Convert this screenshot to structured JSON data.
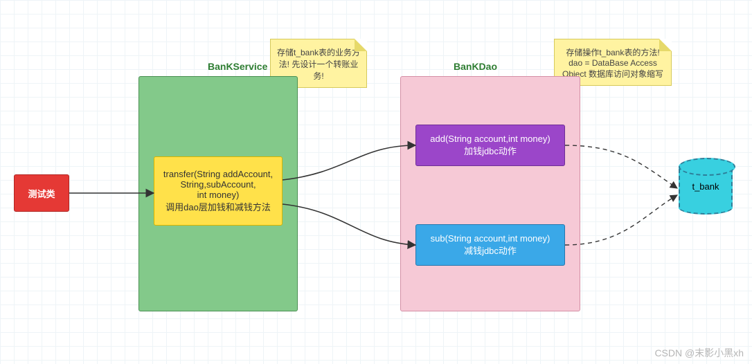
{
  "titles": {
    "service": "BanKService",
    "dao": "BanKDao"
  },
  "notes": {
    "service": "存储t_bank表的业务方法!\n先设计一个转账业务!",
    "dao": "存储操作t_bank表的方法!\ndao = DataBase Access Object\n数据库访问对象缩写"
  },
  "boxes": {
    "test": "测试类",
    "transfer": "transfer(String addAccount,\nString,subAccount,\nint money)\n调用dao层加钱和减钱方法",
    "add": "add(String account,int money)\n加钱jdbc动作",
    "sub": "sub(String account,int money)\n减钱jdbc动作",
    "db": "t_bank"
  },
  "watermark": "CSDN @末影小黑xh"
}
